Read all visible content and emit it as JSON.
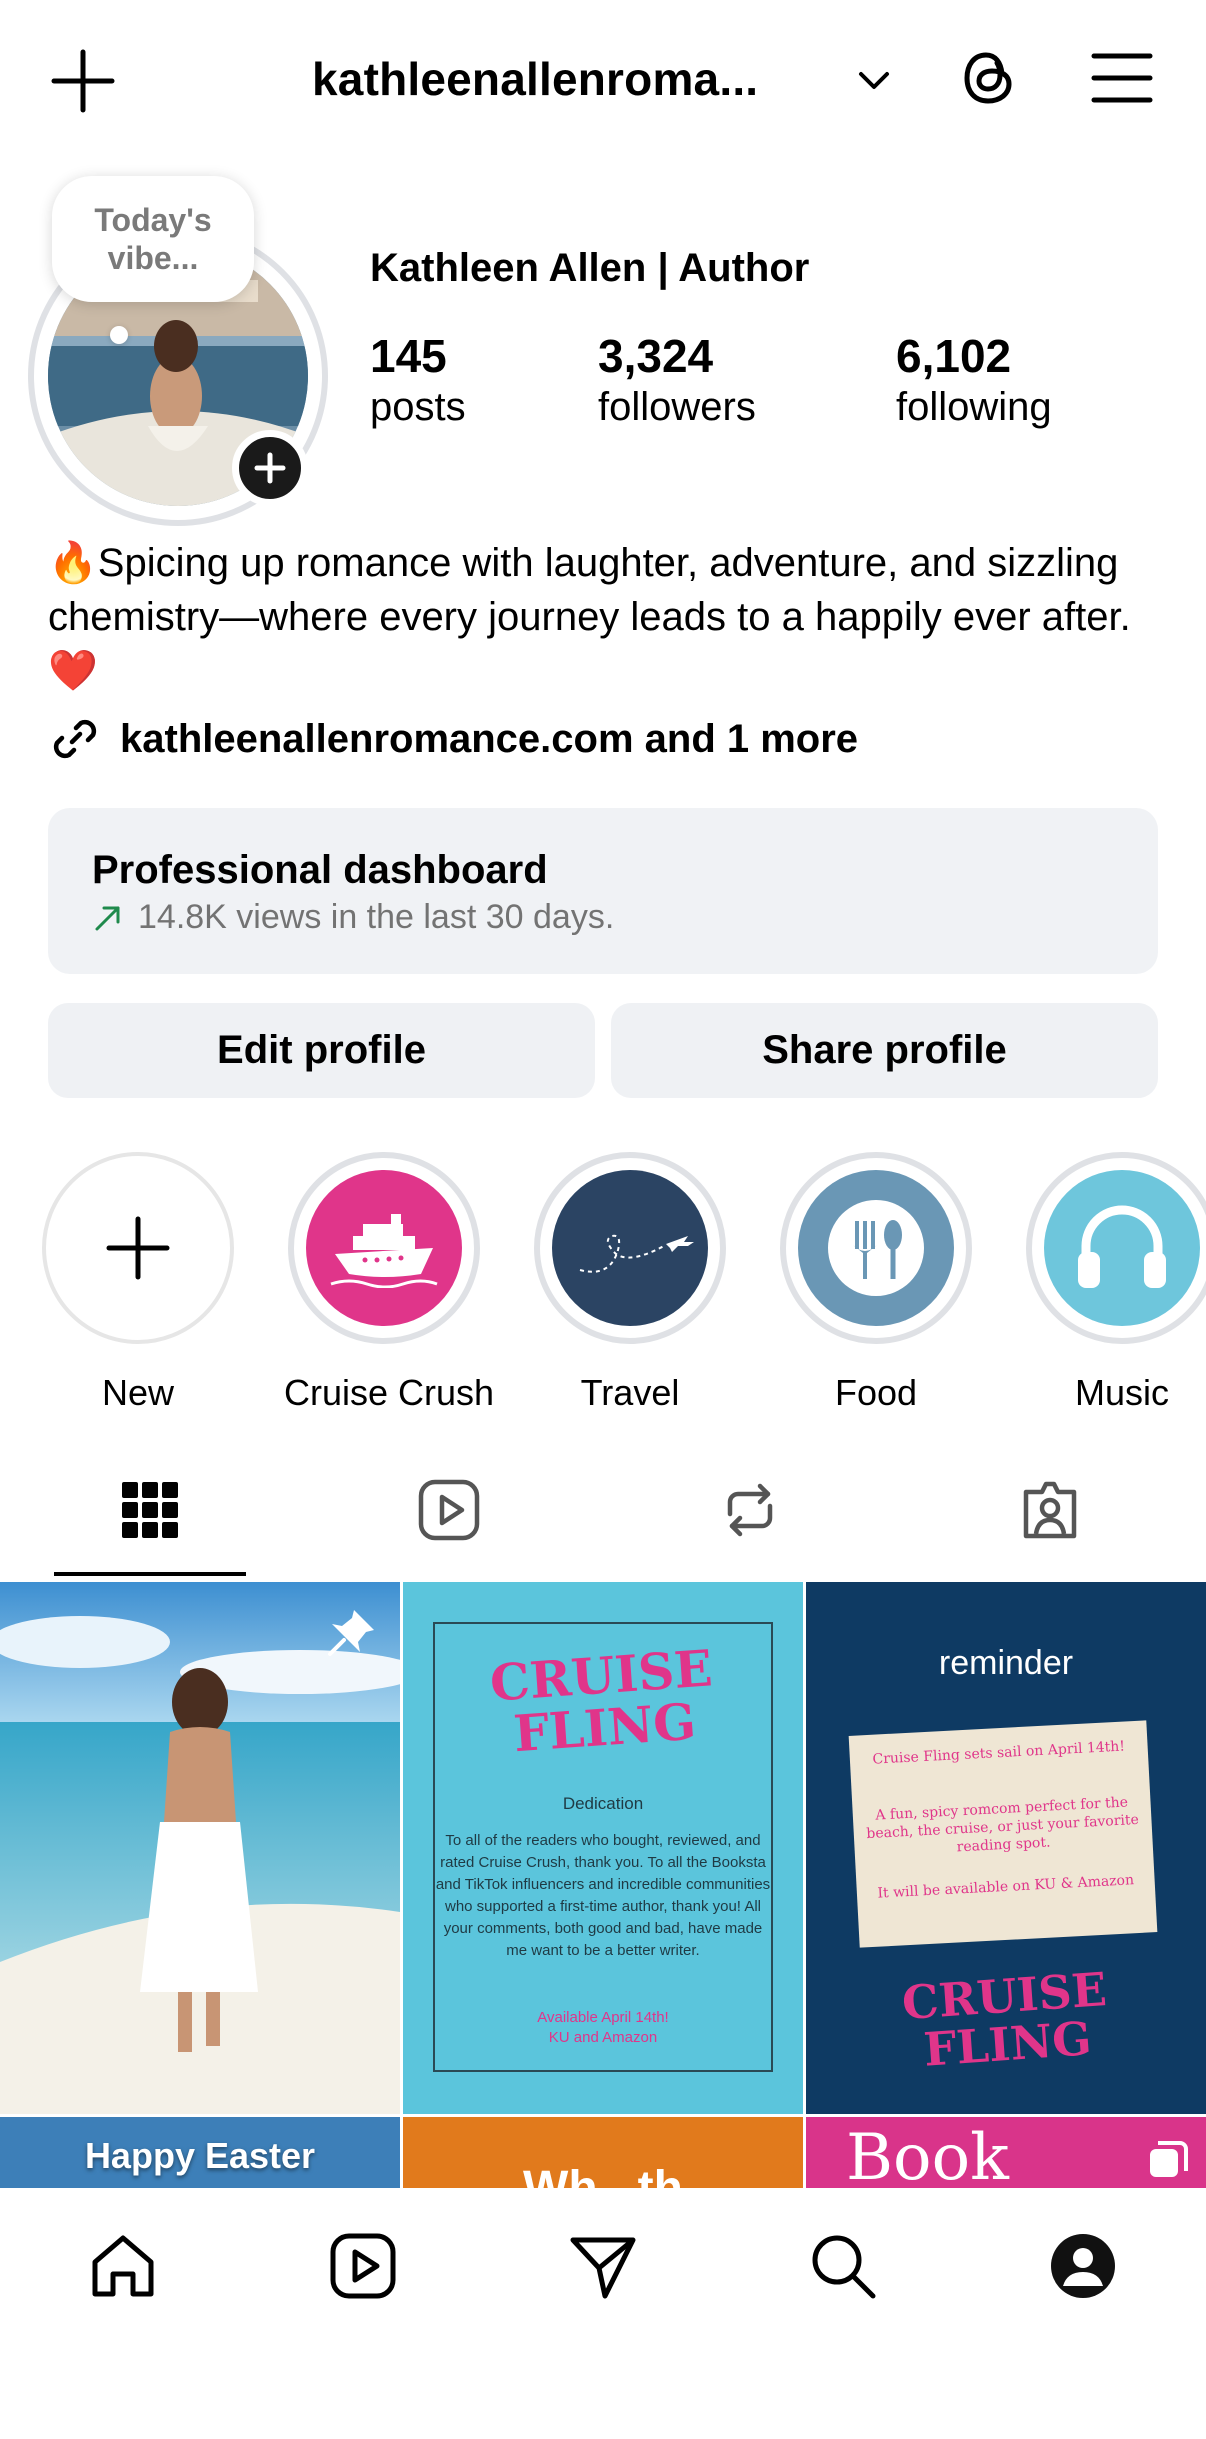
{
  "topbar": {
    "username": "kathleenallenroma...",
    "icons": [
      "plus-icon",
      "chevron-down-icon",
      "threads-icon",
      "menu-icon"
    ]
  },
  "profile": {
    "note": "Today's\nvibe...",
    "display_name": "Kathleen Allen | Author",
    "stats": [
      {
        "value": "145",
        "label": "posts"
      },
      {
        "value": "3,324",
        "label": "followers"
      },
      {
        "value": "6,102",
        "label": "following"
      }
    ],
    "bio": "🔥Spicing up romance with laughter, adventure, and sizzling chemistry—where every journey leads to a happily ever after. ❤️",
    "link": "kathleenallenromance.com and 1 more"
  },
  "dashboard": {
    "title": "Professional dashboard",
    "subtitle": "14.8K views in the last 30 days."
  },
  "buttons": {
    "edit": "Edit profile",
    "share": "Share profile"
  },
  "highlights": [
    {
      "label": "New"
    },
    {
      "label": "Cruise Crush"
    },
    {
      "label": "Travel"
    },
    {
      "label": "Food"
    },
    {
      "label": "Music"
    }
  ],
  "tabs": [
    "grid-icon",
    "reels-icon",
    "reposts-icon",
    "tagged-icon"
  ],
  "posts": {
    "p1_overlay": "",
    "p2": {
      "title1": "CRUISE",
      "title2": "FLING",
      "heading": "Dedication",
      "body": "To all of the readers who bought, reviewed, and rated Cruise Crush, thank you. To all the Booksta and TikTok influencers and incredible communities who supported a first-time author, thank you! All your comments, both good and bad, have made me want to be a better writer.",
      "footer1": "Available April 14th!",
      "footer2": "KU and Amazon"
    },
    "p3": {
      "reminder": "reminder",
      "line1": "Cruise Fling sets sail on April 14th!",
      "line2": "A fun, spicy romcom perfect for the beach, the cruise, or just your favorite reading spot.",
      "line3": "It will be available on KU & Amazon",
      "title1": "CRUISE",
      "title2": "FLING"
    },
    "p4": "Happy Easter",
    "p5": "Wh...th",
    "p6": "Book"
  },
  "bottom_nav": [
    "home-icon",
    "reels-icon",
    "messages-icon",
    "search-icon",
    "profile-icon"
  ],
  "colors": {
    "accent_pink": "#e0358a",
    "navy": "#2b4463",
    "dashboard_bg": "#f0f2f5",
    "trend_green": "#1f8a4c",
    "post2_bg": "#5bc5dc",
    "post3_bg": "#0e3a63"
  }
}
